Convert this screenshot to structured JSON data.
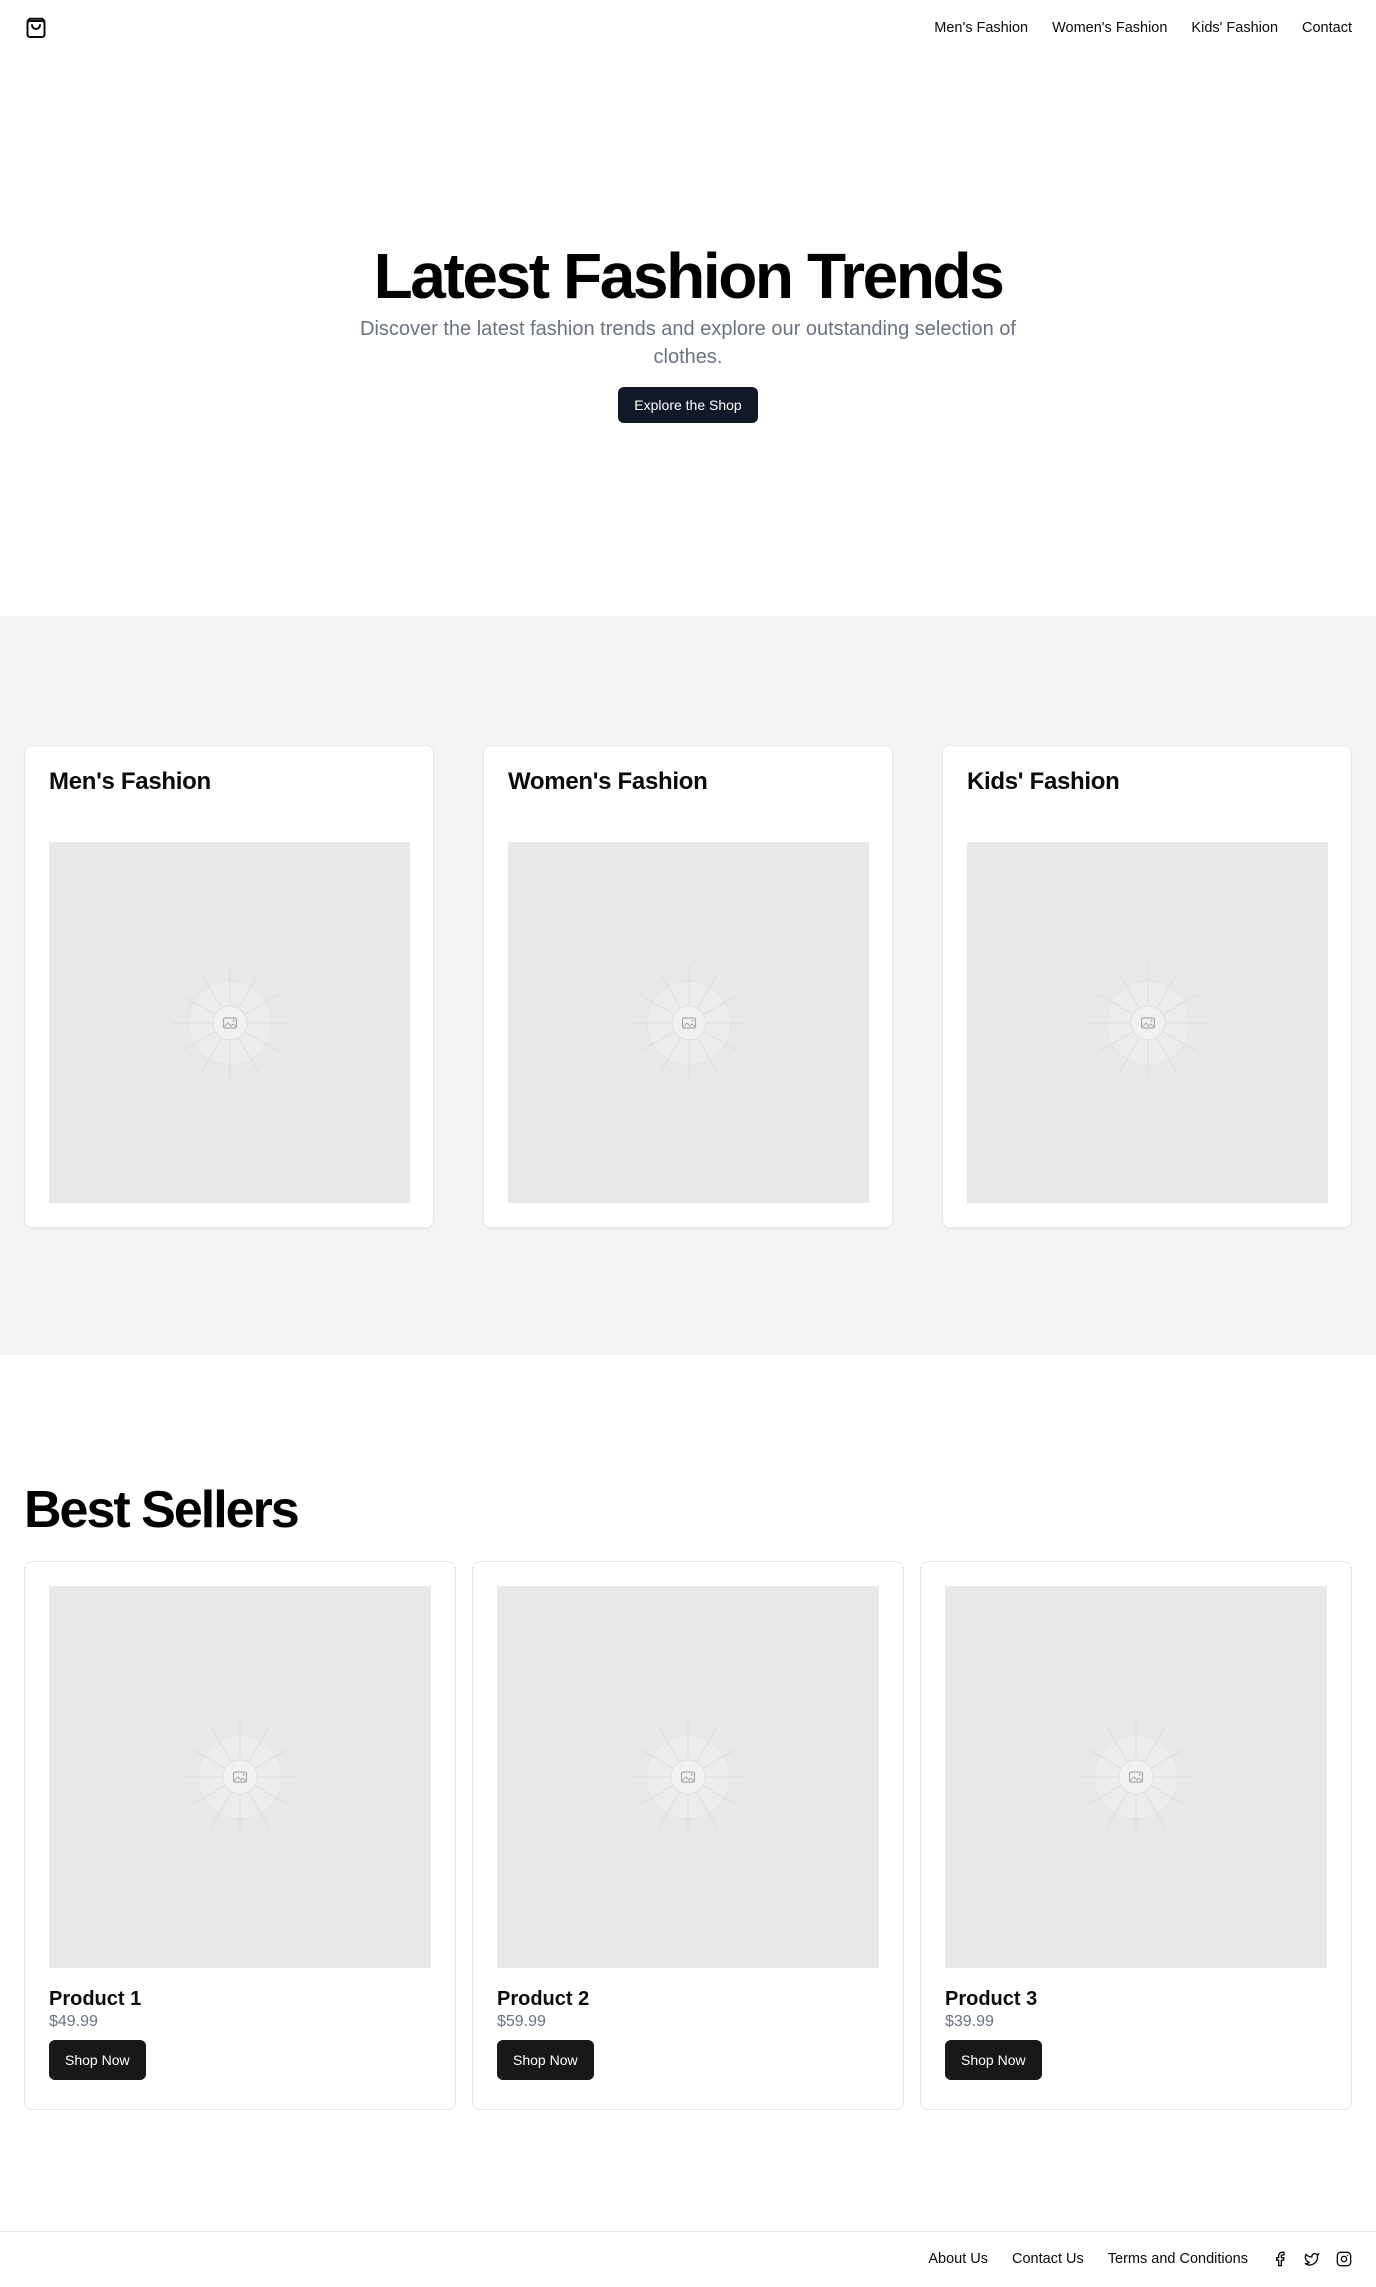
{
  "header": {
    "logo_icon": "shopping-bag-icon",
    "nav": [
      {
        "label": "Men's Fashion"
      },
      {
        "label": "Women's Fashion"
      },
      {
        "label": "Kids' Fashion"
      },
      {
        "label": "Contact"
      }
    ]
  },
  "hero": {
    "title": "Latest Fashion Trends",
    "subtitle": "Discover the latest fashion trends and explore our outstanding selection of clothes.",
    "cta_label": "Explore the Shop"
  },
  "categories": [
    {
      "title": "Men's Fashion",
      "image_icon": "image-placeholder-icon"
    },
    {
      "title": "Women's Fashion",
      "image_icon": "image-placeholder-icon"
    },
    {
      "title": "Kids' Fashion",
      "image_icon": "image-placeholder-icon"
    }
  ],
  "best_sellers": {
    "title": "Best Sellers",
    "products": [
      {
        "name": "Product 1",
        "price": "$49.99",
        "button_label": "Shop Now"
      },
      {
        "name": "Product 2",
        "price": "$59.99",
        "button_label": "Shop Now"
      },
      {
        "name": "Product 3",
        "price": "$39.99",
        "button_label": "Shop Now"
      }
    ]
  },
  "footer": {
    "links": [
      {
        "label": "About Us"
      },
      {
        "label": "Contact Us"
      },
      {
        "label": "Terms and Conditions"
      }
    ],
    "social_icons": [
      "facebook-icon",
      "twitter-icon",
      "instagram-icon"
    ]
  },
  "colors": {
    "primary_button": "#111827",
    "dark_button": "#18181b",
    "muted_text": "#6b7280",
    "section_bg": "#f3f4f6",
    "placeholder_bg": "#e8e8e8"
  }
}
